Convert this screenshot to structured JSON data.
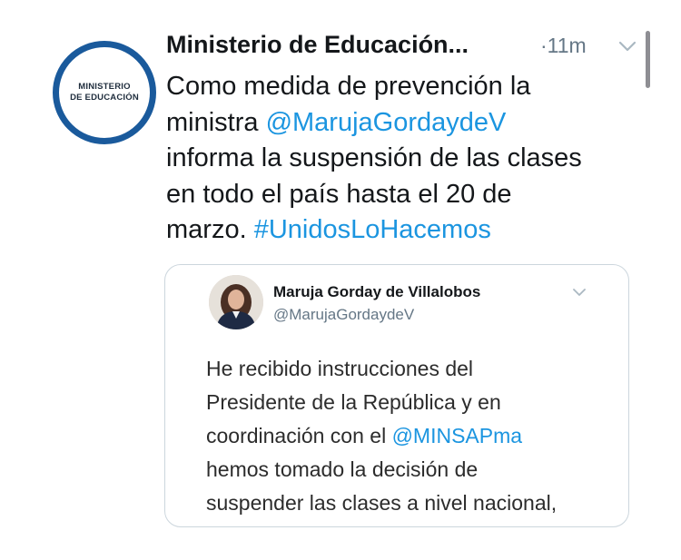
{
  "tweet": {
    "avatar_lines": [
      "MINISTERIO",
      "DE EDUCACIÓN"
    ],
    "author_name": "Ministerio de Educación...",
    "time": "·11m",
    "text_line1": "Como medida de prevención la",
    "text_line2_prefix": "ministra ",
    "mention": "@MarujaGordaydeV",
    "text_line3": "informa la suspensión de las clases",
    "text_line4": "en todo el país hasta el 20 de",
    "text_line5_prefix": "marzo. ",
    "hashtag": "#UnidosLoHacemos"
  },
  "quoted_tweet": {
    "author_name": "Maruja Gorday de Villalobos",
    "handle": "@MarujaGordaydeV",
    "line1": "He recibido instrucciones del",
    "line2": "Presidente de la República y en",
    "line3_prefix": "coordinación con el ",
    "line3_mention": "@MINSAPma",
    "line4": "hemos tomado la decisión de",
    "line5": "suspender las clases a nivel nacional,"
  },
  "colors": {
    "link": "#1b95e0",
    "secondary_text": "#657786",
    "avatar_ring": "#1a5a9c"
  },
  "icons": [
    "chevron-down-icon",
    "quote-chevron-down-icon"
  ]
}
